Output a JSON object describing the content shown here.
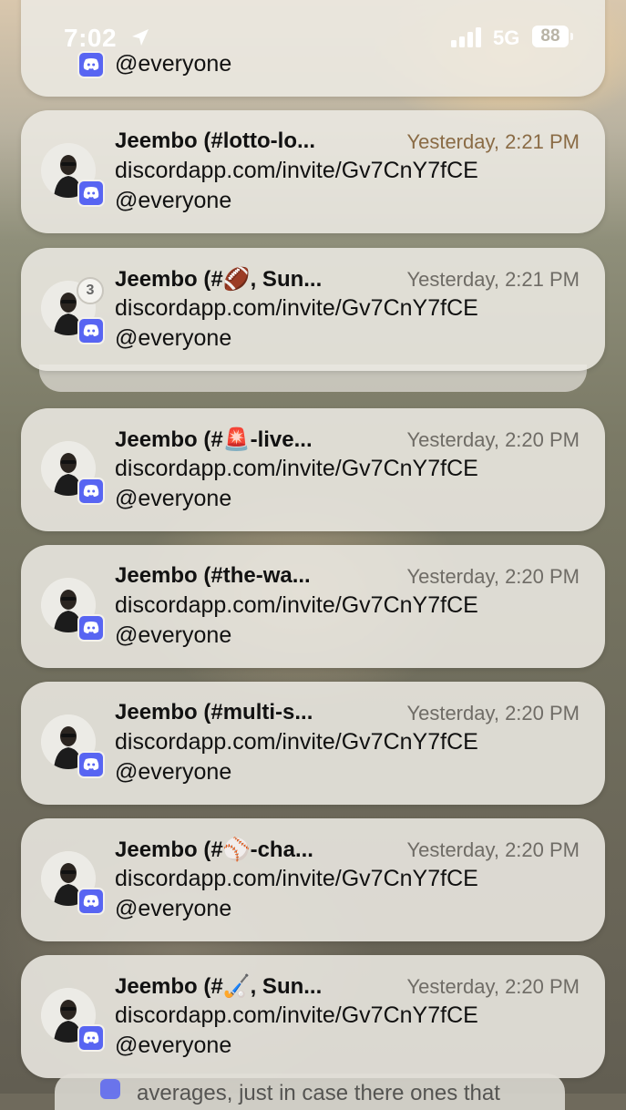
{
  "status_bar": {
    "time": "7:02",
    "network": "5G",
    "battery": "88",
    "icons": [
      "location-arrow-icon",
      "signal-bars-icon",
      "battery-icon"
    ]
  },
  "top_partial": {
    "line2": "@everyone"
  },
  "notifications": [
    {
      "title": "Jeembo (#lotto-lo...",
      "time": "Yesterday, 2:21 PM",
      "line1": "discordapp.com/invite/Gv7CnY7fCE",
      "line2": "@everyone"
    },
    {
      "title": "Jeembo (#🏈, Sun...",
      "time": "Yesterday, 2:21 PM",
      "line1": "discordapp.com/invite/Gv7CnY7fCE",
      "line2": "@everyone",
      "stack_count": "3"
    },
    {
      "title": "Jeembo (#🚨-live...",
      "time": "Yesterday, 2:20 PM",
      "line1": "discordapp.com/invite/Gv7CnY7fCE",
      "line2": "@everyone"
    },
    {
      "title": "Jeembo (#the-wa...",
      "time": "Yesterday, 2:20 PM",
      "line1": "discordapp.com/invite/Gv7CnY7fCE",
      "line2": "@everyone"
    },
    {
      "title": "Jeembo (#multi-s...",
      "time": "Yesterday, 2:20 PM",
      "line1": "discordapp.com/invite/Gv7CnY7fCE",
      "line2": "@everyone"
    },
    {
      "title": "Jeembo (#⚾-cha...",
      "time": "Yesterday, 2:20 PM",
      "line1": "discordapp.com/invite/Gv7CnY7fCE",
      "line2": "@everyone"
    },
    {
      "title": "Jeembo (#🏑, Sun...",
      "time": "Yesterday, 2:20 PM",
      "line1": "discordapp.com/invite/Gv7CnY7fCE",
      "line2": "@everyone"
    }
  ],
  "bottom_peek": {
    "text": "averages, just in case there ones that"
  },
  "colors": {
    "discord": "#5865f2",
    "card": "#ece9e2"
  }
}
